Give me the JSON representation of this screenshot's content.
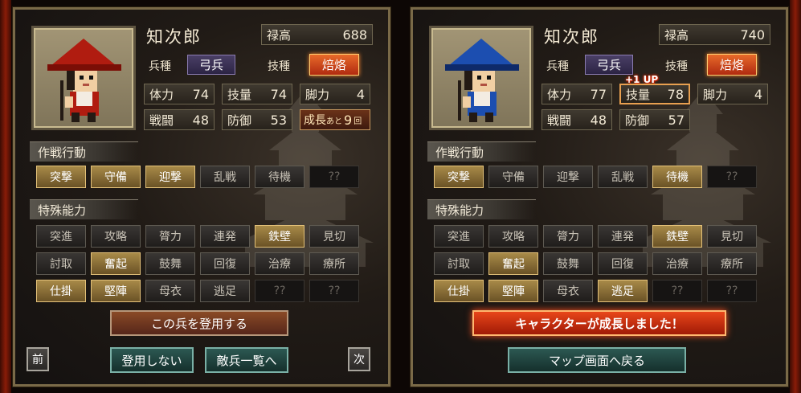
{
  "left": {
    "name": "知次郎",
    "stipend_label": "禄高",
    "stipend_value": "688",
    "troop_type_label": "兵種",
    "troop_type": "弓兵",
    "skill_label": "技種",
    "skill": "焙烙",
    "stats": {
      "hp_label": "体力",
      "hp": "74",
      "tech_label": "技量",
      "tech": "74",
      "leg_label": "脚力",
      "leg": "4",
      "combat_label": "戦闘",
      "combat": "48",
      "defense_label": "防御",
      "defense": "53"
    },
    "growth": {
      "prefix": "成長",
      "small": "あと",
      "num": "9",
      "suffix": "回"
    },
    "tactics_header": "作戦行動",
    "tactics": [
      "突撃",
      "守備",
      "迎撃",
      "乱戦",
      "待機",
      "??"
    ],
    "abilities_header": "特殊能力",
    "abilities": [
      "突進",
      "攻略",
      "膂力",
      "連発",
      "鉄壁",
      "見切",
      "討取",
      "奮起",
      "鼓舞",
      "回復",
      "治療",
      "療所",
      "仕掛",
      "堅陣",
      "母衣",
      "逃足",
      "??",
      "??"
    ],
    "recruit_button": "この兵を登用する",
    "prev_button": "前",
    "decline_button": "登用しない",
    "enemy_list_button": "敵兵一覧へ",
    "next_button": "次"
  },
  "right": {
    "name": "知次郎",
    "stipend_label": "禄高",
    "stipend_value": "740",
    "troop_type_label": "兵種",
    "troop_type": "弓兵",
    "skill_label": "技種",
    "skill": "焙烙",
    "levelup": "+1 UP",
    "stats": {
      "hp_label": "体力",
      "hp": "77",
      "tech_label": "技量",
      "tech": "78",
      "leg_label": "脚力",
      "leg": "4",
      "combat_label": "戦闘",
      "combat": "48",
      "defense_label": "防御",
      "defense": "57"
    },
    "tactics_header": "作戦行動",
    "tactics": [
      "突撃",
      "守備",
      "迎撃",
      "乱戦",
      "待機",
      "??"
    ],
    "abilities_header": "特殊能力",
    "abilities": [
      "突進",
      "攻略",
      "膂力",
      "連発",
      "鉄壁",
      "見切",
      "討取",
      "奮起",
      "鼓舞",
      "回復",
      "治療",
      "療所",
      "仕掛",
      "堅陣",
      "母衣",
      "逃足",
      "??",
      "??"
    ],
    "growth_banner": "キャラクターが成長しました！",
    "return_button": "マップ画面へ戻る"
  },
  "colors": {
    "left_hat": "#b01c10",
    "right_hat": "#1c4eb0"
  }
}
